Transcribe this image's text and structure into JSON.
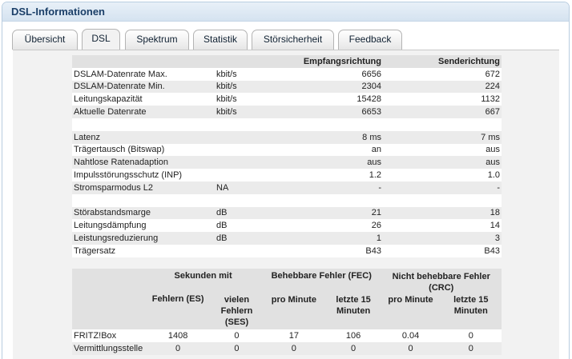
{
  "title": "DSL-Informationen",
  "tabs": [
    "Übersicht",
    "DSL",
    "Spektrum",
    "Statistik",
    "Störsicherheit",
    "Feedback"
  ],
  "active_tab": "DSL",
  "table": {
    "col_down": "Empfangsrichtung",
    "col_up": "Senderichtung",
    "rows": [
      {
        "label": "DSLAM-Datenrate Max.",
        "unit": "kbit/s",
        "down": "6656",
        "up": "672"
      },
      {
        "label": "DSLAM-Datenrate Min.",
        "unit": "kbit/s",
        "down": "2304",
        "up": "224"
      },
      {
        "label": "Leitungskapazität",
        "unit": "kbit/s",
        "down": "15428",
        "up": "1132"
      },
      {
        "label": "Aktuelle Datenrate",
        "unit": "kbit/s",
        "down": "6653",
        "up": "667"
      },
      {
        "label": "Latenz",
        "unit": "",
        "down": "8 ms",
        "up": "7 ms"
      },
      {
        "label": "Trägertausch (Bitswap)",
        "unit": "",
        "down": "an",
        "up": "aus"
      },
      {
        "label": "Nahtlose Ratenadaption",
        "unit": "",
        "down": "aus",
        "up": "aus"
      },
      {
        "label": "Impulsstörungsschutz (INP)",
        "unit": "",
        "down": "1.2",
        "up": "1.0"
      },
      {
        "label": "Stromsparmodus L2",
        "unit": "NA",
        "down": "-",
        "up": "-"
      },
      {
        "label": "Störabstandsmarge",
        "unit": "dB",
        "down": "21",
        "up": "18"
      },
      {
        "label": "Leitungsdämpfung",
        "unit": "dB",
        "down": "26",
        "up": "14"
      },
      {
        "label": "Leistungsreduzierung",
        "unit": "dB",
        "down": "1",
        "up": "3"
      },
      {
        "label": "Trägersatz",
        "unit": "",
        "down": "B43",
        "up": "B43"
      }
    ]
  },
  "errors": {
    "group1": "Sekunden mit",
    "group2": "Behebbare Fehler (FEC)",
    "group3": "Nicht behebbare Fehler (CRC)",
    "sub": [
      "Fehlern (ES)",
      "vielen Fehlern (SES)",
      "pro Minute",
      "letzte 15 Minuten",
      "pro Minute",
      "letzte 15 Minuten"
    ],
    "rows": [
      {
        "label": "FRITZ!Box",
        "values": [
          "1408",
          "0",
          "17",
          "106",
          "0.04",
          "0"
        ]
      },
      {
        "label": "Vermittlungsstelle",
        "values": [
          "0",
          "0",
          "0",
          "0",
          "0",
          "0"
        ]
      }
    ]
  }
}
